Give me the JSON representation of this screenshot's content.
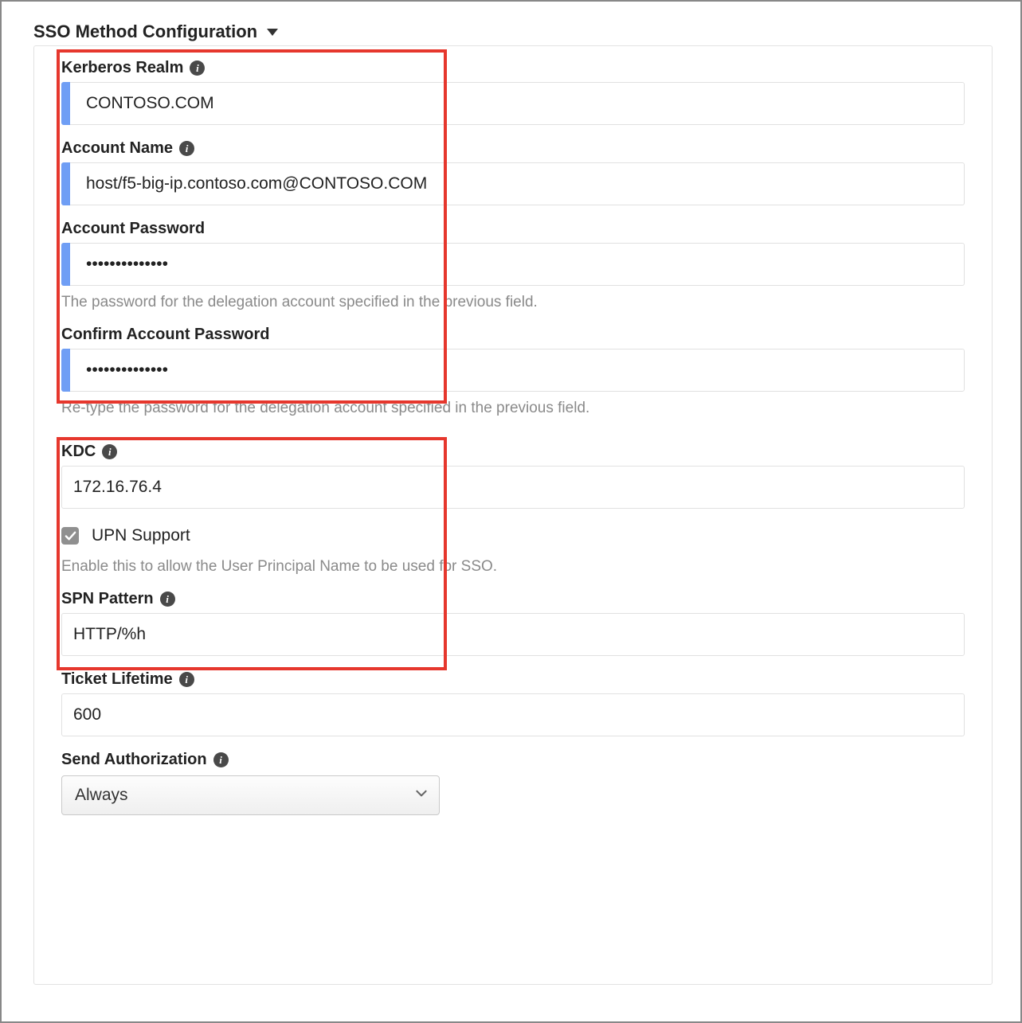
{
  "section": {
    "title": "SSO Method Configuration"
  },
  "fields": {
    "kerberos_realm": {
      "label": "Kerberos Realm",
      "value": "CONTOSO.COM"
    },
    "account_name": {
      "label": "Account Name",
      "value": "host/f5-big-ip.contoso.com@CONTOSO.COM"
    },
    "account_password": {
      "label": "Account Password",
      "value": "••••••••••••••",
      "help": "The password for the delegation account specified in the previous field."
    },
    "confirm_password": {
      "label": "Confirm Account Password",
      "value": "••••••••••••••",
      "help": "Re-type the password for the delegation account specified in the previous field."
    },
    "kdc": {
      "label": "KDC",
      "value": "172.16.76.4"
    },
    "upn_support": {
      "label": "UPN Support",
      "checked": true,
      "help": "Enable this to allow the User Principal Name to be used for SSO."
    },
    "spn_pattern": {
      "label": "SPN Pattern",
      "value": "HTTP/%h"
    },
    "ticket_lifetime": {
      "label": "Ticket Lifetime",
      "value": "600"
    },
    "send_authorization": {
      "label": "Send Authorization",
      "value": "Always"
    }
  }
}
